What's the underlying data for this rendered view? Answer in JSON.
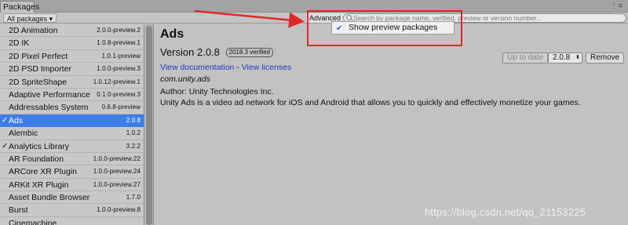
{
  "window": {
    "tab_label": "Packages",
    "menu_glyph": "⋮≡"
  },
  "toolbar": {
    "filter_label": "All packages ▾",
    "advanced_label": "Advanced ▾",
    "search_placeholder": "Search by package name, verified, preview or version number..."
  },
  "advanced_menu": {
    "items": [
      {
        "label": "Show preview packages",
        "checked": true,
        "check_glyph": "✔"
      }
    ]
  },
  "packages": [
    {
      "name": "2D Animation",
      "version": "2.0.0-preview.2",
      "installed": false
    },
    {
      "name": "2D IK",
      "version": "1.0.8-preview.1",
      "installed": false
    },
    {
      "name": "2D Pixel Perfect",
      "version": "1.0.1-preview",
      "installed": false
    },
    {
      "name": "2D PSD Importer",
      "version": "1.0.0-preview.3",
      "installed": false
    },
    {
      "name": "2D SpriteShape",
      "version": "1.0.12-preview.1",
      "installed": false
    },
    {
      "name": "Adaptive Performance",
      "version": "0.1.0-preview.3",
      "installed": false
    },
    {
      "name": "Addressables System",
      "version": "0.6.8-preview",
      "installed": false
    },
    {
      "name": "Ads",
      "version": "2.0.8",
      "installed": true,
      "selected": true
    },
    {
      "name": "Alembic",
      "version": "1.0.2",
      "installed": false
    },
    {
      "name": "Analytics Library",
      "version": "3.2.2",
      "installed": true
    },
    {
      "name": "AR Foundation",
      "version": "1.0.0-preview.22",
      "installed": false
    },
    {
      "name": "ARCore XR Plugin",
      "version": "1.0.0-preview.24",
      "installed": false
    },
    {
      "name": "ARKit XR Plugin",
      "version": "1.0.0-preview.27",
      "installed": false
    },
    {
      "name": "Asset Bundle Browser",
      "version": "1.7.0",
      "installed": false
    },
    {
      "name": "Burst",
      "version": "1.0.0-preview.8",
      "installed": false
    },
    {
      "name": "Cinemachine",
      "version": "",
      "installed": false
    }
  ],
  "check_glyph": "✓",
  "details": {
    "title": "Ads",
    "version_label": "Version 2.0.8",
    "verified_badge": "2018.3 verified",
    "link_docs": "View documentation",
    "link_sep": " - ",
    "link_licenses": "View licenses",
    "package_id": "com.unity.ads",
    "author": "Author: Unity Technologies Inc.",
    "description": "Unity Ads is a video ad network for iOS and Android that allows you to quickly and effectively monetize your games.",
    "up_to_date_label": "Up to date",
    "selected_version": "2.0.8",
    "version_caret": "⬍",
    "remove_label": "Remove"
  },
  "annotation": {
    "color": "#e0282a"
  },
  "watermark": "https://blog.csdn.net/qq_21153225"
}
